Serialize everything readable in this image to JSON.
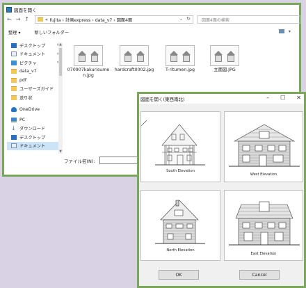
{
  "file_dialog": {
    "title": "図面を開く",
    "nav": {
      "back": "←",
      "forward": "→",
      "up": "↑"
    },
    "address": {
      "prefix": "«",
      "path": "fujita › 計画express › data_v7 › 図面4面",
      "refresh": "↻",
      "caret": "⌄"
    },
    "search_placeholder": "図面4面の検索",
    "toolbar": {
      "organize": "整理 ▾",
      "new_folder": "新しいフォルダー"
    },
    "sidebar": [
      {
        "label": "デスクトップ",
        "icon": "desktop-icon",
        "pinned": true
      },
      {
        "label": "ドキュメント",
        "icon": "documents-icon",
        "pinned": true
      },
      {
        "label": "ピクチャ",
        "icon": "pictures-icon",
        "pinned": true
      },
      {
        "label": "data_v7",
        "icon": "folder-icon",
        "pinned": false
      },
      {
        "label": "pdf",
        "icon": "folder-icon",
        "pinned": false
      },
      {
        "label": "ユーザーズガイド",
        "icon": "folder-icon",
        "pinned": false
      },
      {
        "label": "送り状",
        "icon": "folder-icon",
        "pinned": false
      },
      {
        "label": "OneDrive",
        "icon": "cloud-icon",
        "pinned": false
      },
      {
        "label": "PC",
        "icon": "pc-icon",
        "pinned": false
      },
      {
        "label": "ダウンロード",
        "icon": "download-icon",
        "pinned": false
      },
      {
        "label": "デスクトップ",
        "icon": "desktop-icon",
        "pinned": false
      },
      {
        "label": "ドキュメント",
        "icon": "documents-icon",
        "pinned": false,
        "selected": true
      }
    ],
    "files": [
      {
        "name": "070907kakurisumen.jpg"
      },
      {
        "name": "hardcraft0002.jpg"
      },
      {
        "name": "T-ritumen.jpg"
      },
      {
        "name": "立面図.JPG"
      }
    ],
    "filename_label": "ファイル名(N):"
  },
  "elevation_dialog": {
    "title": "図面を開く(東西南北)",
    "controls": {
      "minimize": "–",
      "maximize": "☐",
      "close": "✕"
    },
    "panels": [
      {
        "caption": "South Elevation"
      },
      {
        "caption": "West Elevation"
      },
      {
        "caption": "North Elevation"
      },
      {
        "caption": "East Elevation"
      }
    ],
    "ok_label": "OK",
    "cancel_label": "Cancel"
  }
}
